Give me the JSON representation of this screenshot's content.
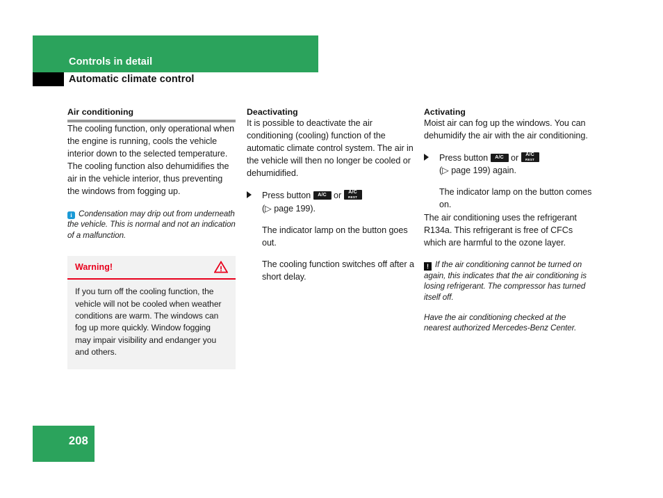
{
  "header": {
    "chapter_title": "Controls in detail",
    "section_title": "Automatic climate control",
    "green_color": "#2ba35c"
  },
  "columns": {
    "left": {
      "heading": "Air conditioning",
      "paragraph": "The cooling function, only operational when the engine is running, cools the vehicle interior down to the selected temperature. The cooling function also dehumidifies the air in the vehicle interior, thus preventing the windows from fogging up.",
      "note": {
        "icon": "info-icon",
        "text": "Condensation may drip out from underneath the vehicle. This is normal and not an indication of a malfunction."
      },
      "warning": {
        "title": "Warning!",
        "icon": "warning-triangle-icon",
        "text": "If you turn off the cooling function, the vehicle will not be cooled when weather conditions are warm. The windows can fog up more quickly. Window fogging may impair visibility and endanger you and others.",
        "accent_color": "#e8001c",
        "background_color": "#f2f2f2"
      }
    },
    "middle": {
      "heading": "Deactivating",
      "paragraph": "It is possible to deactivate the air conditioning (cooling) function of the automatic climate control system. The air in the vehicle will then no longer be cooled or dehumidified.",
      "step": {
        "marker": "arrow-right-icon",
        "text_before": "Press button",
        "key_1": "A/C",
        "or": "or",
        "key_2_line1": "A/C",
        "key_2_line2": "REST",
        "reference": "(▷ page 199)."
      },
      "result_1": "The indicator lamp on the button goes out.",
      "result_2": "The cooling function switches off after a short delay."
    },
    "right": {
      "heading": "Activating",
      "paragraph": "Moist air can fog up the windows. You can dehumidify the air with the air conditioning.",
      "step": {
        "marker": "arrow-right-icon",
        "text_before": "Press button",
        "key_1": "A/C",
        "or": "or",
        "key_2_line1": "A/C",
        "key_2_line2": "REST",
        "reference": "(▷ page 199) again."
      },
      "result_1": "The indicator lamp on the button comes on.",
      "paragraph_2": "The air conditioning uses the refrigerant R134a. This refrigerant is free of CFCs which are harmful to the ozone layer.",
      "note": {
        "icon": "exclamation-box-icon",
        "text": "If the air conditioning cannot be turned on again, this indicates that the air conditioning is losing refrigerant. The compressor has turned itself off."
      },
      "note_2": "Have the air conditioning checked at the nearest authorized Mercedes-Benz Center."
    }
  },
  "footer": {
    "page_number": "208"
  }
}
